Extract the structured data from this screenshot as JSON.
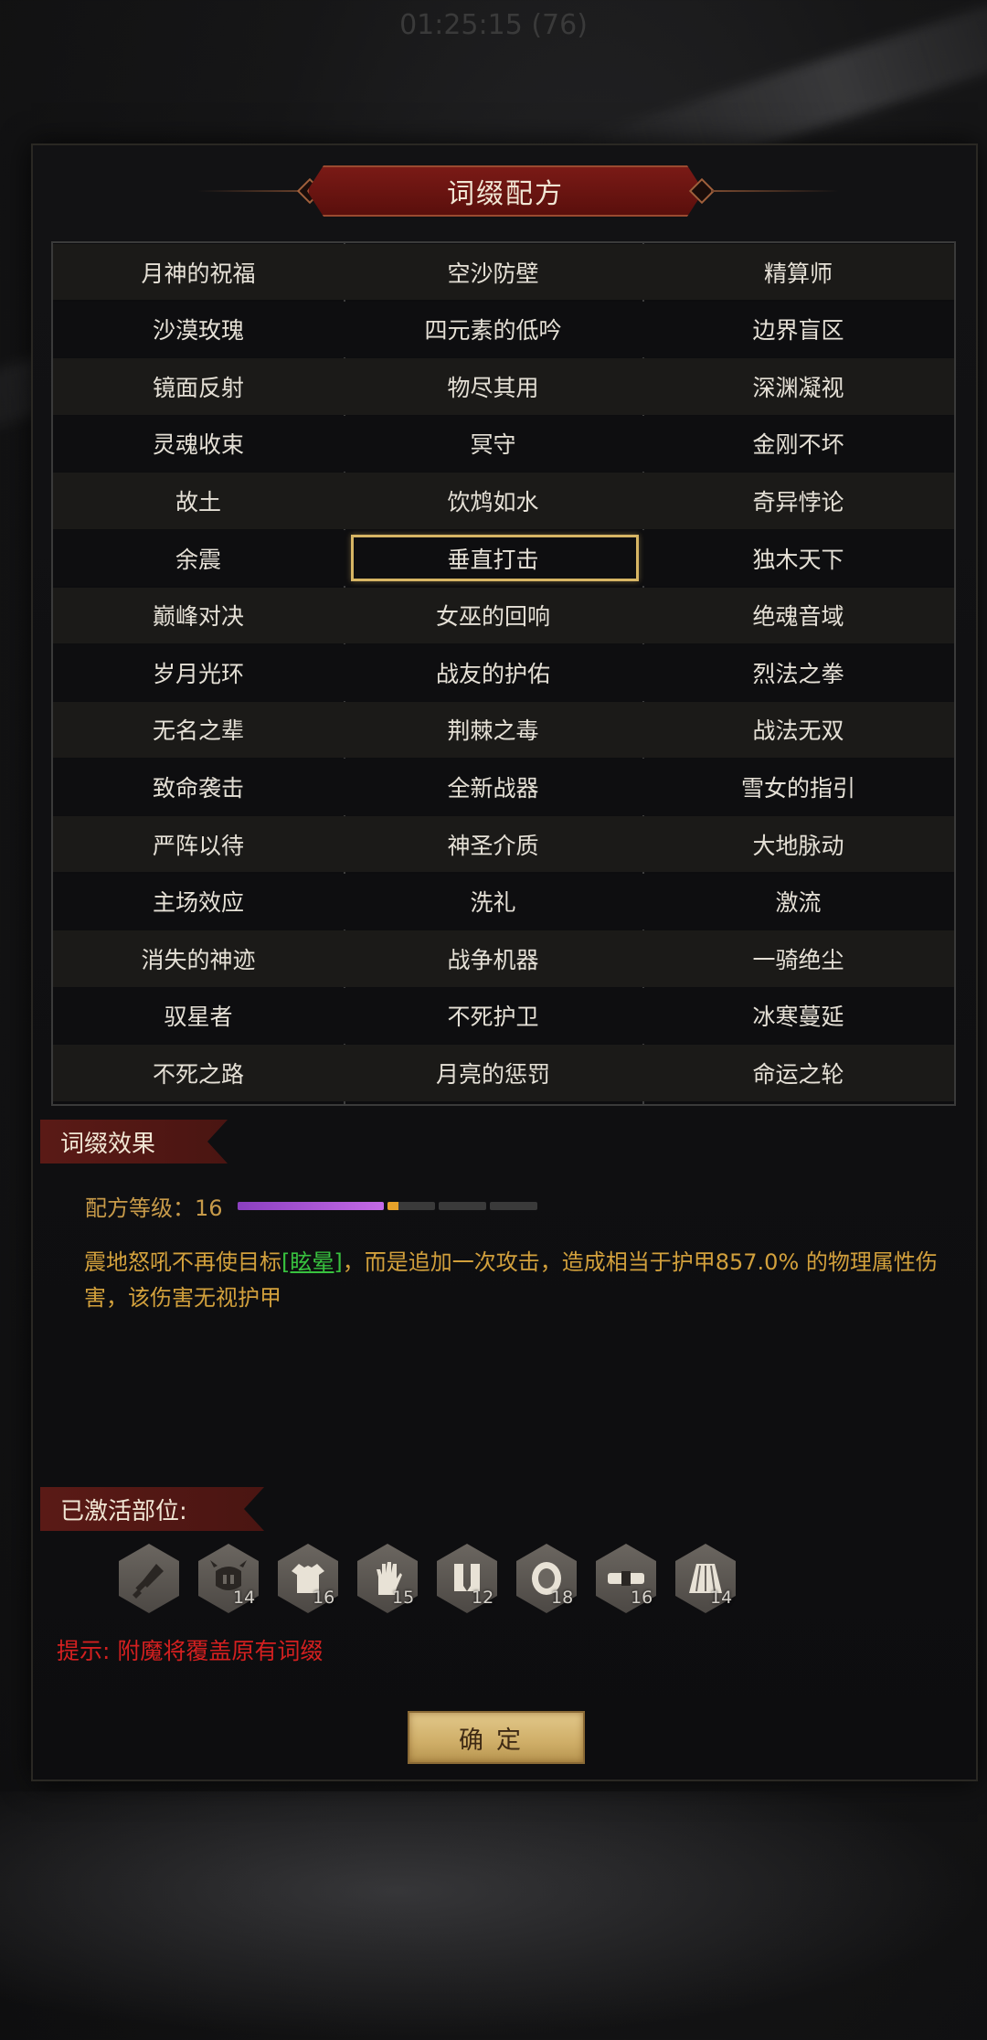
{
  "status": {
    "time": "01:25:15 (76)"
  },
  "title": "词缀配方",
  "affixes": [
    [
      "月神的祝福",
      "空沙防壁",
      "精算师"
    ],
    [
      "沙漠玫瑰",
      "四元素的低吟",
      "边界盲区"
    ],
    [
      "镜面反射",
      "物尽其用",
      "深渊凝视"
    ],
    [
      "灵魂收束",
      "冥守",
      "金刚不坏"
    ],
    [
      "故土",
      "饮鸩如水",
      "奇异悖论"
    ],
    [
      "余震",
      "垂直打击",
      "独木天下"
    ],
    [
      "巅峰对决",
      "女巫的回响",
      "绝魂音域"
    ],
    [
      "岁月光环",
      "战友的护佑",
      "烈法之拳"
    ],
    [
      "无名之辈",
      "荆棘之毒",
      "战法无双"
    ],
    [
      "致命袭击",
      "全新战器",
      "雪女的指引"
    ],
    [
      "严阵以待",
      "神圣介质",
      "大地脉动"
    ],
    [
      "主场效应",
      "洗礼",
      "激流"
    ],
    [
      "消失的神迹",
      "战争机器",
      "一骑绝尘"
    ],
    [
      "驭星者",
      "不死护卫",
      "冰寒蔓延"
    ],
    [
      "不死之路",
      "月亮的惩罚",
      "命运之轮"
    ]
  ],
  "selected": {
    "row": 5,
    "col": 1
  },
  "effect": {
    "tag": "词缀效果",
    "level_label": "配方等级：16",
    "level_progress": 0.56,
    "desc_pre": "震地怒吼不再使目标",
    "desc_highlight": "[眩晕]",
    "desc_post": "，而是追加一次攻击，造成相当于护甲857.0% 的物理属性伤害，该伤害无视护甲"
  },
  "activated": {
    "tag": "已激活部位:",
    "slots": [
      {
        "icon": "dagger-icon",
        "level": ""
      },
      {
        "icon": "helmet-icon",
        "level": "14"
      },
      {
        "icon": "armor-icon",
        "level": "16"
      },
      {
        "icon": "glove-icon",
        "level": "15"
      },
      {
        "icon": "boots-icon",
        "level": "12"
      },
      {
        "icon": "ring-icon",
        "level": "18"
      },
      {
        "icon": "belt-icon",
        "level": "16"
      },
      {
        "icon": "skirt-icon",
        "level": "14"
      }
    ]
  },
  "hint": "提示: 附魔将覆盖原有词缀",
  "confirm_label": "确定",
  "colors": {
    "accent_gold": "#d7b564",
    "desc_text": "#d2a03c",
    "highlight": "#38c23f",
    "hint_red": "#d42020",
    "progress_purple": "#a94fd6",
    "progress_orange": "#e7a22a"
  }
}
